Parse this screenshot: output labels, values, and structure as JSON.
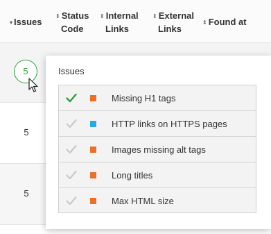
{
  "header": {
    "issues_label": "Issues",
    "status_label_1": "Status",
    "status_label_2": "Code",
    "internal_label_1": "Internal",
    "internal_label_2": "Links",
    "external_label_1": "External",
    "external_label_2": "Links",
    "found_label": "Found at"
  },
  "rows": [
    {
      "issues": "5"
    },
    {
      "issues": "5"
    },
    {
      "issues": "5"
    }
  ],
  "popover": {
    "title": "Issues",
    "items": [
      {
        "label": "Missing H1 tags",
        "checked": true,
        "color": "#e8702a"
      },
      {
        "label": "HTTP links on HTTPS pages",
        "checked": false,
        "color": "#29a9e1"
      },
      {
        "label": "Images missing alt tags",
        "checked": false,
        "color": "#e8702a"
      },
      {
        "label": "Long titles",
        "checked": false,
        "color": "#e8702a"
      },
      {
        "label": "Max HTML size",
        "checked": false,
        "color": "#e8702a"
      }
    ]
  },
  "colors": {
    "check_active": "#2e9e3a",
    "check_inactive": "#c9c9c9",
    "circle": "#2e9e3a"
  },
  "icons": {
    "sort": "sort-icon",
    "check": "check-icon",
    "cursor": "mouse-cursor-icon"
  }
}
